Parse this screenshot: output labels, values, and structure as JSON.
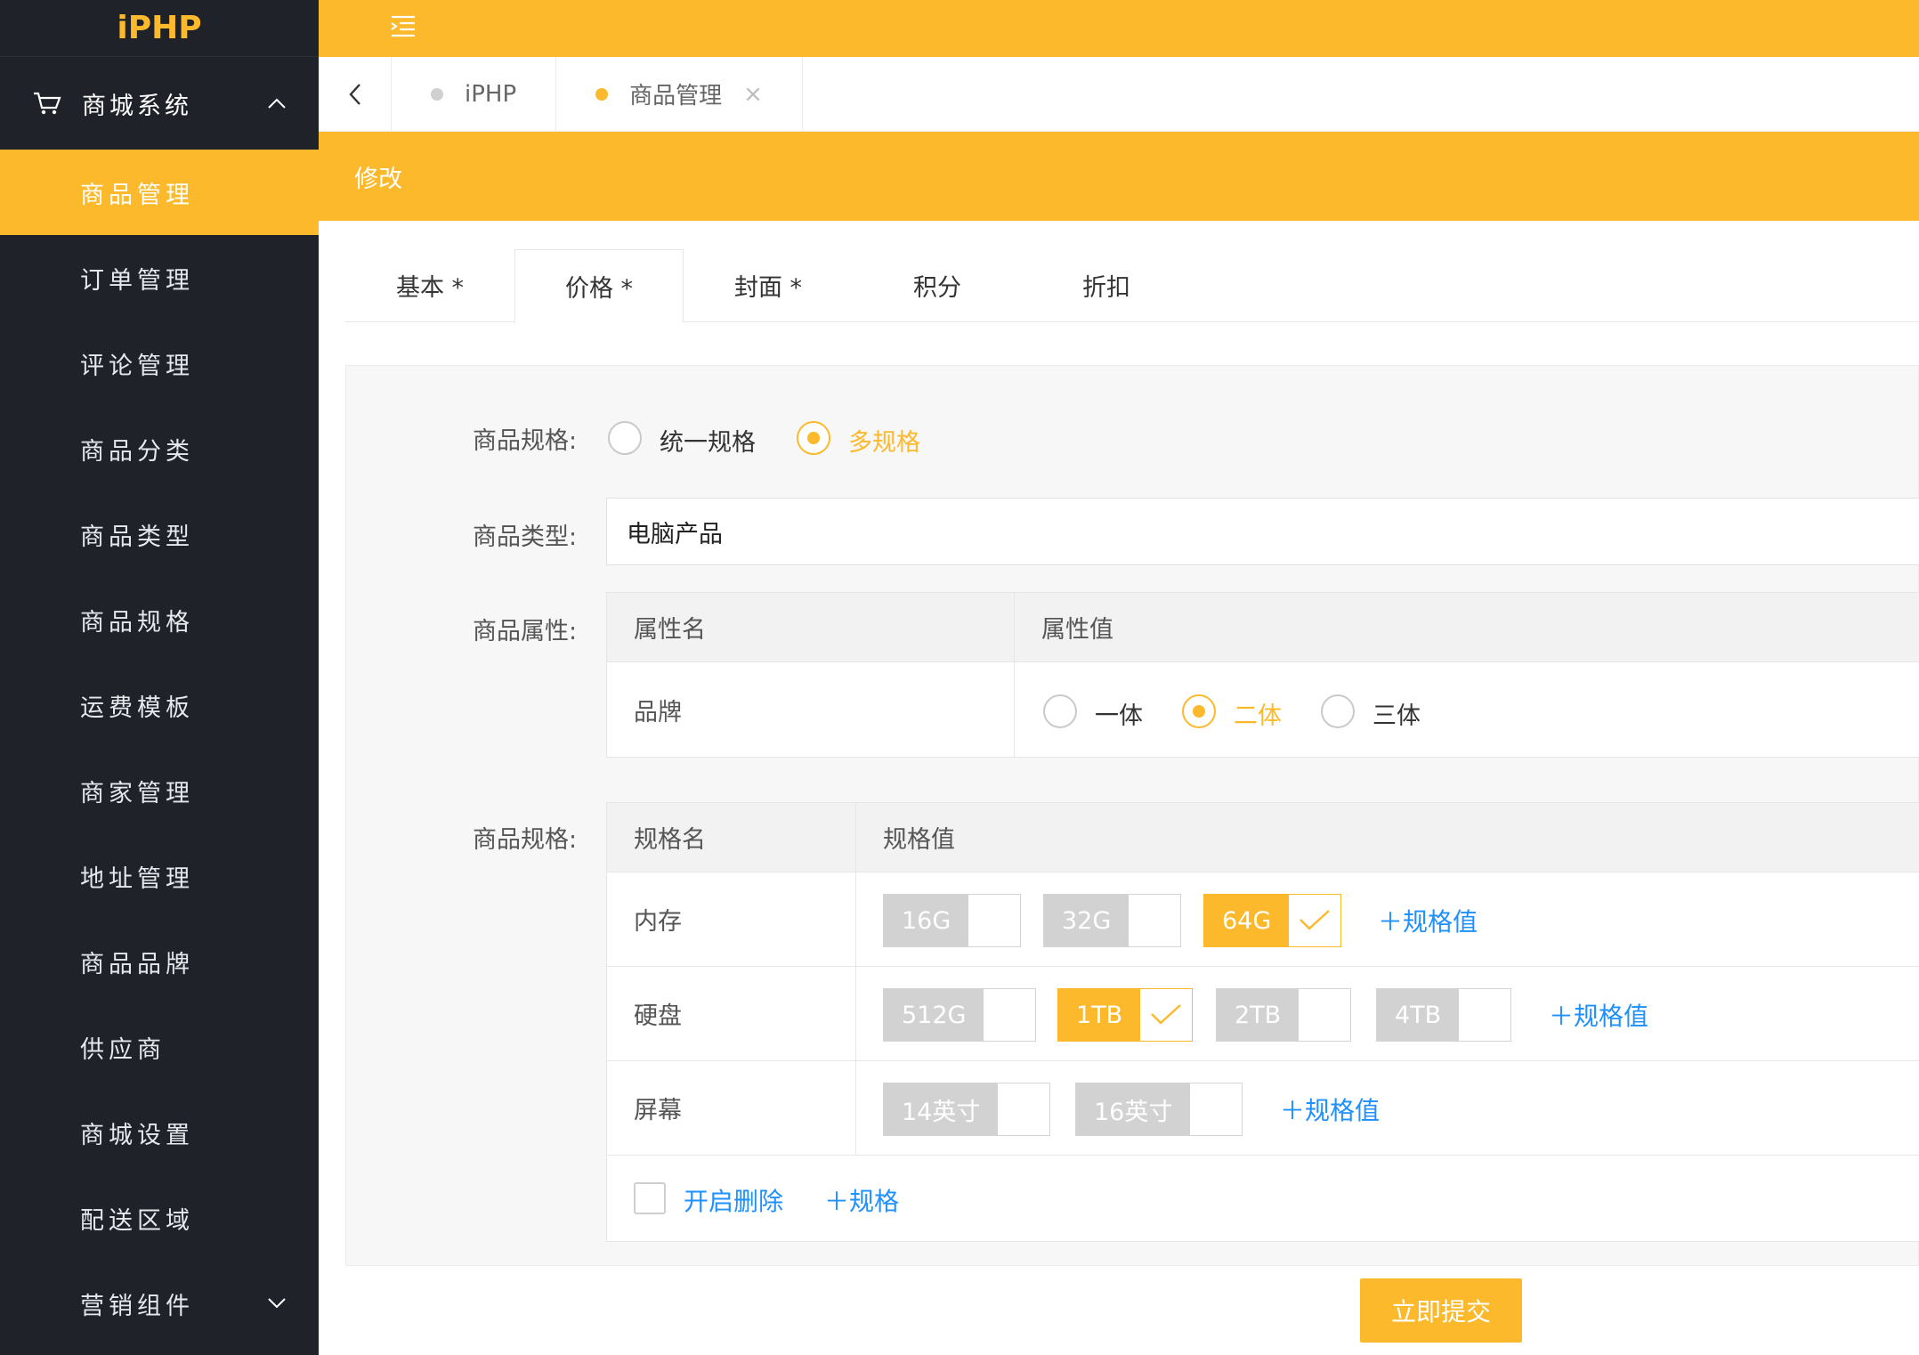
{
  "app": {
    "logo": "iPHP"
  },
  "sidebar": {
    "group": "商城系统",
    "items": [
      {
        "label": "商品管理"
      },
      {
        "label": "订单管理"
      },
      {
        "label": "评论管理"
      },
      {
        "label": "商品分类"
      },
      {
        "label": "商品类型"
      },
      {
        "label": "商品规格"
      },
      {
        "label": "运费模板"
      },
      {
        "label": "商家管理"
      },
      {
        "label": "地址管理"
      },
      {
        "label": "商品品牌"
      },
      {
        "label": "供应商"
      },
      {
        "label": "商城设置"
      },
      {
        "label": "配送区域"
      },
      {
        "label": "营销组件"
      }
    ]
  },
  "tabs": [
    {
      "label": "iPHP"
    },
    {
      "label": "商品管理",
      "close": "×"
    }
  ],
  "card": {
    "title": "修改"
  },
  "form_tabs": [
    "基本 *",
    "价格 *",
    "封面 *",
    "积分",
    "折扣"
  ],
  "form": {
    "spec_mode_label": "商品规格:",
    "spec_mode_options": [
      "统一规格",
      "多规格"
    ],
    "type_label": "商品类型:",
    "type_value": "电脑产品",
    "attr_label": "商品属性:",
    "attr_table": {
      "col_name": "属性名",
      "col_value": "属性值",
      "row_name": "品牌",
      "options": [
        "一体",
        "二体",
        "三体"
      ]
    },
    "spec_label": "商品规格:",
    "spec_table": {
      "col_name": "规格名",
      "col_value": "规格值",
      "rows": [
        {
          "name": "内存",
          "values": [
            "16G",
            "32G",
            "64G"
          ],
          "add": "＋规格值"
        },
        {
          "name": "硬盘",
          "values": [
            "512G",
            "1TB",
            "2TB",
            "4TB"
          ],
          "add": "＋规格值"
        },
        {
          "name": "屏幕",
          "values": [
            "14英寸",
            "16英寸"
          ],
          "add": "＋规格值"
        }
      ],
      "enable_delete": "开启删除",
      "add_spec": "＋规格"
    },
    "submit": "立即提交"
  },
  "colors": {
    "accent": "#fbb92b",
    "sidebar": "#1f2229",
    "link": "#1e90ff"
  }
}
